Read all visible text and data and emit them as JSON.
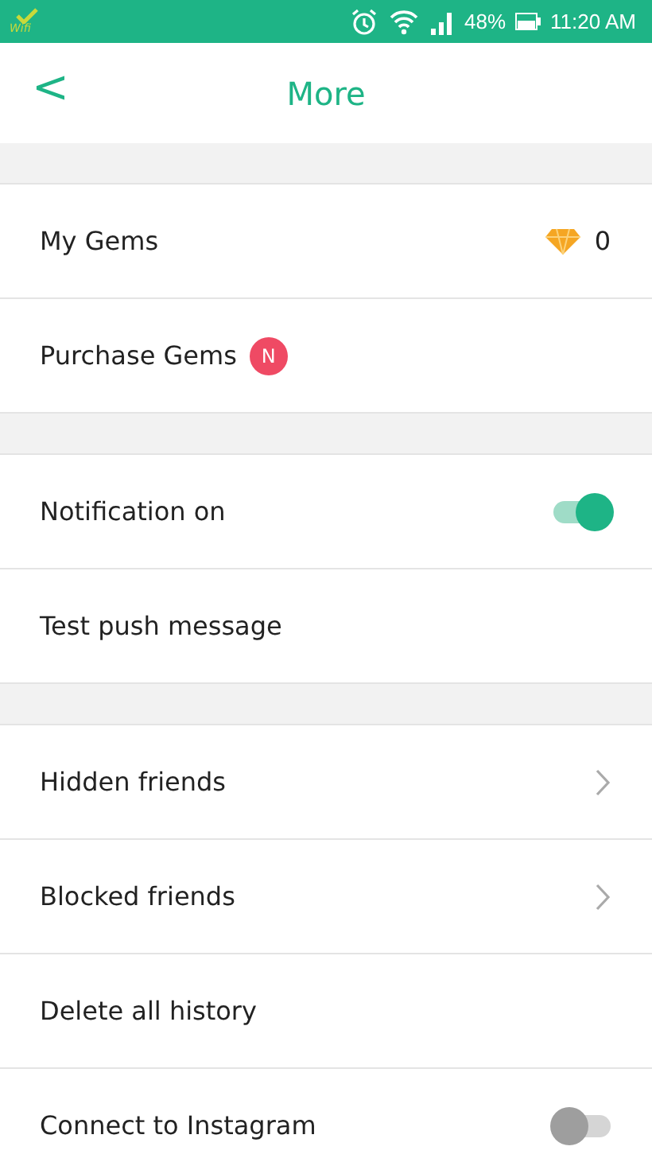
{
  "status_bar": {
    "wifi_label": "Wifi",
    "battery": "48%",
    "time": "11:20 AM"
  },
  "header": {
    "back": "<",
    "title": "More"
  },
  "groups": [
    [
      {
        "kind": "value",
        "label": "My Gems",
        "value": "0"
      },
      {
        "kind": "badge",
        "label": "Purchase Gems",
        "badge": "N"
      }
    ],
    [
      {
        "kind": "toggle",
        "label": "Notification on",
        "on": true
      },
      {
        "kind": "plain",
        "label": "Test push message"
      }
    ],
    [
      {
        "kind": "chevron",
        "label": "Hidden friends"
      },
      {
        "kind": "chevron",
        "label": "Blocked friends"
      },
      {
        "kind": "plain",
        "label": "Delete all history"
      },
      {
        "kind": "toggle",
        "label": "Connect to Instagram",
        "on": false
      }
    ]
  ]
}
